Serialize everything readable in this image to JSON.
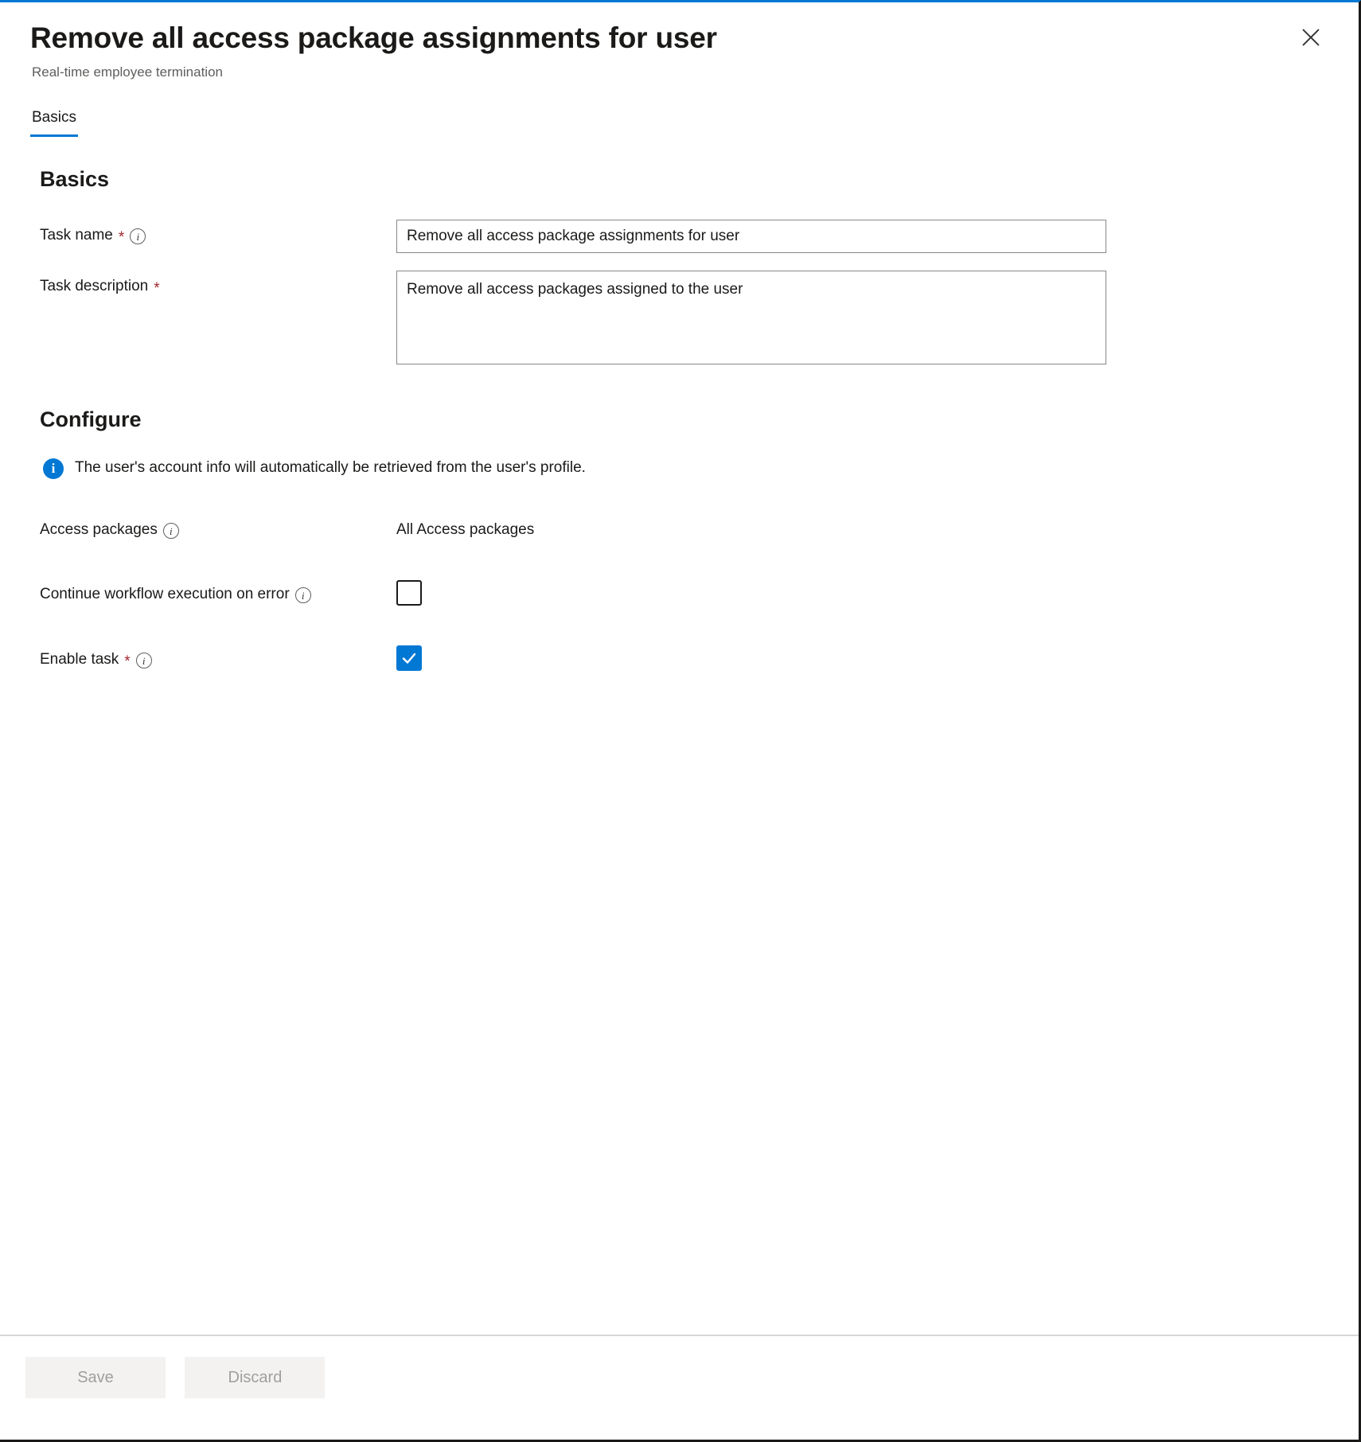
{
  "blade": {
    "title": "Remove all access package assignments for user",
    "subtitle": "Real-time employee termination",
    "close_label": "Close",
    "accent_color": "#0078d4"
  },
  "tabs": [
    {
      "label": "Basics",
      "selected": true
    }
  ],
  "basics": {
    "heading": "Basics",
    "task_name": {
      "label": "Task name",
      "required_marker": "*",
      "info_glyph": "i",
      "value": "Remove all access package assignments for user",
      "placeholder": ""
    },
    "task_description": {
      "label": "Task description",
      "required_marker": "*",
      "value": "Remove all access packages assigned to the user",
      "placeholder": ""
    }
  },
  "configure": {
    "heading": "Configure",
    "info_banner": {
      "icon": "info-icon",
      "icon_glyph": "i",
      "text": "The user's account info will automatically be retrieved from the user's profile.",
      "color": "#0078d4"
    },
    "access_packages": {
      "label": "Access packages",
      "info_glyph": "i",
      "value": "All Access packages"
    },
    "continue_on_error": {
      "label": "Continue workflow execution on error",
      "info_glyph": "i",
      "checked": false
    },
    "enable_task": {
      "label": "Enable task",
      "required_marker": "*",
      "info_glyph": "i",
      "checked": true
    }
  },
  "footer": {
    "save_label": "Save",
    "discard_label": "Discard"
  }
}
